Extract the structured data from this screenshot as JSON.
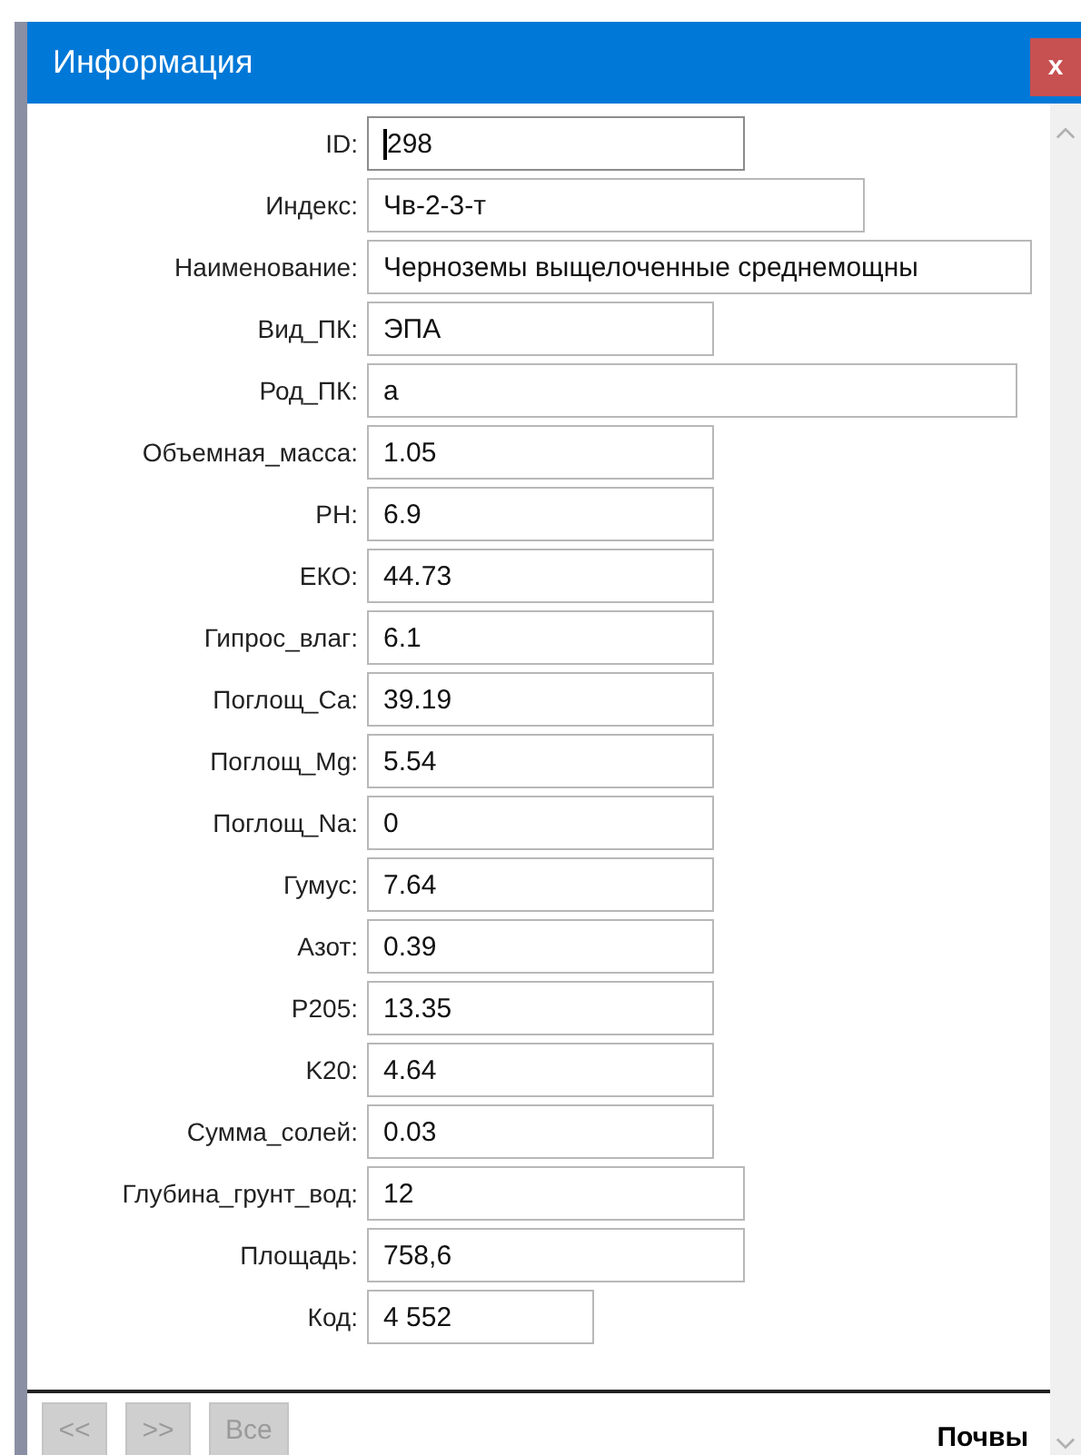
{
  "window": {
    "title": "Информация",
    "close": "x"
  },
  "fields": [
    {
      "label": "ID:",
      "value": "298",
      "focused": true
    },
    {
      "label": "Индекс:",
      "value": "Чв-2-3-т",
      "focused": false
    },
    {
      "label": "Наименование:",
      "value": "Черноземы выщелоченные среднемощны",
      "focused": false
    },
    {
      "label": "Вид_ПК:",
      "value": "ЭПА",
      "focused": false
    },
    {
      "label": "Род_ПК:",
      "value": "а",
      "focused": false
    },
    {
      "label": "Объемная_масса:",
      "value": "1.05",
      "focused": false
    },
    {
      "label": "PH:",
      "value": "6.9",
      "focused": false
    },
    {
      "label": "ЕКО:",
      "value": "44.73",
      "focused": false
    },
    {
      "label": "Гипрос_влаг:",
      "value": "6.1",
      "focused": false
    },
    {
      "label": "Поглощ_Ca:",
      "value": "39.19",
      "focused": false
    },
    {
      "label": "Поглощ_Mg:",
      "value": "5.54",
      "focused": false
    },
    {
      "label": "Поглощ_Na:",
      "value": "0",
      "focused": false
    },
    {
      "label": "Гумус:",
      "value": "7.64",
      "focused": false
    },
    {
      "label": "Азот:",
      "value": "0.39",
      "focused": false
    },
    {
      "label": "P205:",
      "value": "13.35",
      "focused": false
    },
    {
      "label": "K20:",
      "value": "4.64",
      "focused": false
    },
    {
      "label": "Сумма_солей:",
      "value": "0.03",
      "focused": false
    },
    {
      "label": "Глубина_грунт_вод:",
      "value": "12",
      "focused": false
    },
    {
      "label": "Площадь:",
      "value": "758,6",
      "focused": false
    },
    {
      "label": "Код:",
      "value": "4 552",
      "focused": false
    }
  ],
  "buttons": [
    {
      "label": "<<",
      "disabled": true
    },
    {
      "label": ">>",
      "disabled": true
    },
    {
      "label": "Все",
      "disabled": true
    }
  ],
  "layer": "Почвы"
}
